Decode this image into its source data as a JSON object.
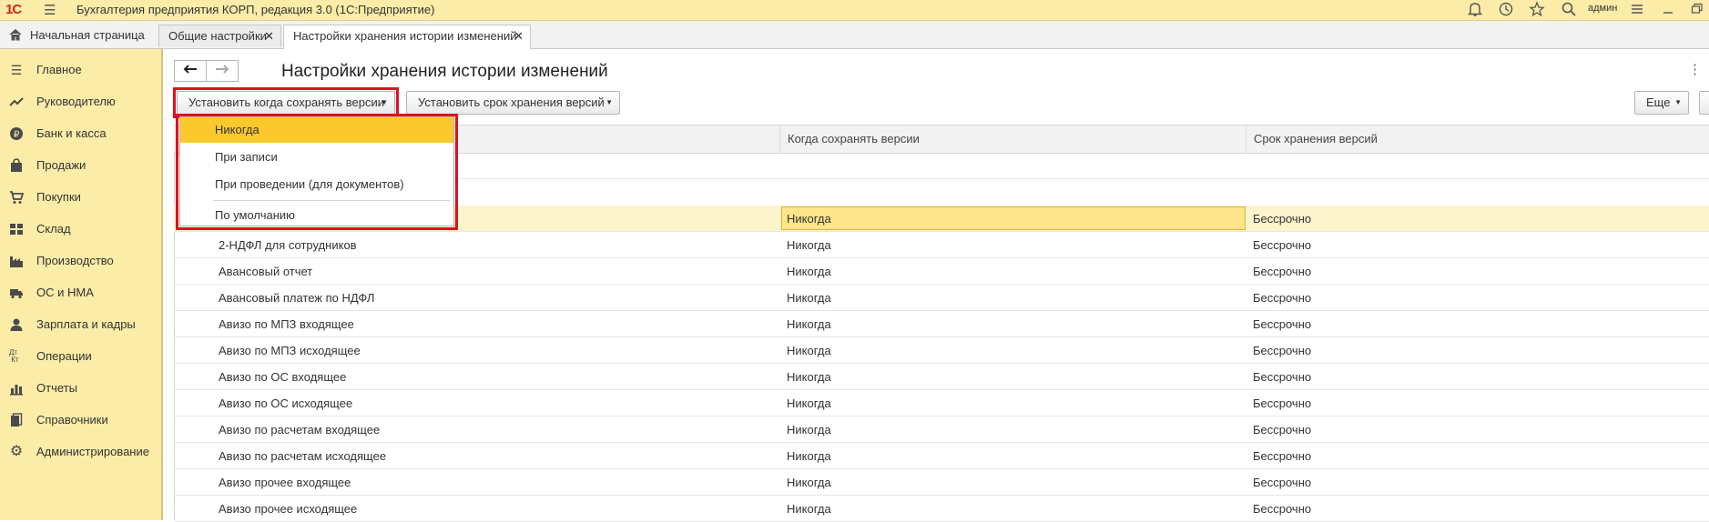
{
  "app": {
    "logo": "1С",
    "title": "Бухгалтерия предприятия КОРП, редакция 3.0  (1С:Предприятие)",
    "user": "админ"
  },
  "tabs": [
    {
      "label": "Начальная страница"
    },
    {
      "label": "Общие настройки",
      "close": "✕"
    },
    {
      "label": "Настройки хранения истории изменений",
      "close": "✕"
    }
  ],
  "sidebar": {
    "items": [
      {
        "label": "Главное",
        "icon": "menu-icon"
      },
      {
        "label": "Руководителю",
        "icon": "trend-icon"
      },
      {
        "label": "Банк и касса",
        "icon": "coin-icon"
      },
      {
        "label": "Продажи",
        "icon": "bag-icon"
      },
      {
        "label": "Покупки",
        "icon": "cart-icon"
      },
      {
        "label": "Склад",
        "icon": "grid-icon"
      },
      {
        "label": "Производство",
        "icon": "factory-icon"
      },
      {
        "label": "ОС и НМА",
        "icon": "truck-icon"
      },
      {
        "label": "Зарплата и кадры",
        "icon": "person-icon"
      },
      {
        "label": "Операции",
        "icon": "dtkt-icon"
      },
      {
        "label": "Отчеты",
        "icon": "bars-icon"
      },
      {
        "label": "Справочники",
        "icon": "books-icon"
      },
      {
        "label": "Администрирование",
        "icon": "gear-icon"
      }
    ]
  },
  "page": {
    "title": "Настройки хранения истории изменений",
    "back": "🡐",
    "forward": "🡒"
  },
  "toolbar": {
    "set_when_label": "Установить когда сохранять версии",
    "set_period_label": "Установить срок хранения версий",
    "more_label": "Еще"
  },
  "dropdown": {
    "items": [
      "Никогда",
      "При записи",
      "При проведении (для документов)",
      "По умолчанию"
    ]
  },
  "table": {
    "columns": [
      "",
      "Когда сохранять версии",
      "Срок хранения версий"
    ],
    "rows": [
      {
        "name": "",
        "when": "Никогда",
        "period": "Бессрочно"
      },
      {
        "name": "2-НДФЛ для сотрудников",
        "when": "Никогда",
        "period": "Бессрочно"
      },
      {
        "name": "Авансовый отчет",
        "when": "Никогда",
        "period": "Бессрочно"
      },
      {
        "name": "Авансовый платеж по НДФЛ",
        "when": "Никогда",
        "period": "Бессрочно"
      },
      {
        "name": "Авизо по МПЗ входящее",
        "when": "Никогда",
        "period": "Бессрочно"
      },
      {
        "name": "Авизо по МПЗ исходящее",
        "when": "Никогда",
        "period": "Бессрочно"
      },
      {
        "name": "Авизо по ОС входящее",
        "when": "Никогда",
        "period": "Бессрочно"
      },
      {
        "name": "Авизо по ОС исходящее",
        "when": "Никогда",
        "period": "Бессрочно"
      },
      {
        "name": "Авизо по расчетам входящее",
        "when": "Никогда",
        "period": "Бессрочно"
      },
      {
        "name": "Авизо по расчетам исходящее",
        "when": "Никогда",
        "period": "Бессрочно"
      },
      {
        "name": "Авизо прочее входящее",
        "when": "Никогда",
        "period": "Бессрочно"
      },
      {
        "name": "Авизо прочее исходящее",
        "when": "Никогда",
        "period": "Бессрочно"
      }
    ]
  },
  "colors": {
    "sidebar_bg": "#fbeca8",
    "highlight": "#fbc92e",
    "callout_red": "#e0101e"
  }
}
